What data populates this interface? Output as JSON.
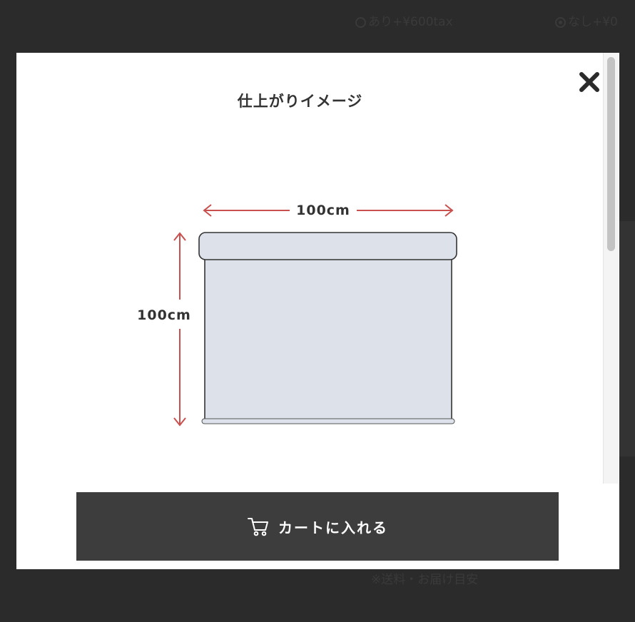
{
  "background": {
    "option_yes": "あり+¥600tax",
    "option_no": "なし+¥0",
    "footer_note": "※送料・お届け目安"
  },
  "modal": {
    "title": "仕上がりイメージ",
    "width_label": "100cm",
    "height_label": "100cm",
    "cart_button_label": "カートに入れる"
  },
  "icons": {
    "close": "close-icon",
    "cart": "cart-icon"
  },
  "colors": {
    "overlay": "#2b2b2b",
    "modal_bg": "#ffffff",
    "arrow": "#c8504f",
    "blind_fill": "#dde2ea",
    "button_bg": "#3d3d3d",
    "button_text": "#ffffff"
  }
}
